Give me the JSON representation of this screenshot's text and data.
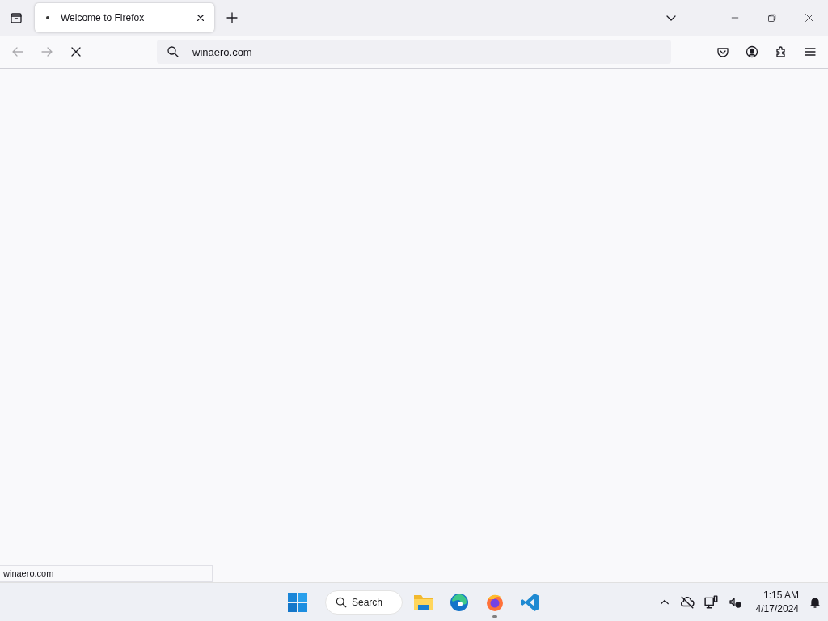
{
  "tabs": [
    {
      "label": "Welcome to Firefox",
      "selected": true,
      "loading": true
    }
  ],
  "address_bar": {
    "value": "winaero.com"
  },
  "navigation": {
    "back_disabled": true,
    "forward_disabled": true,
    "loading": true
  },
  "status_text": "winaero.com",
  "taskbar": {
    "search": {
      "placeholder": "Search"
    },
    "apps": [
      {
        "kind": "files",
        "running": false
      },
      {
        "kind": "edge",
        "running": false
      },
      {
        "kind": "firefox",
        "running": true
      },
      {
        "kind": "vscode",
        "running": false
      }
    ],
    "clock": {
      "time": "1:15 AM",
      "date": "4/17/2024"
    }
  }
}
